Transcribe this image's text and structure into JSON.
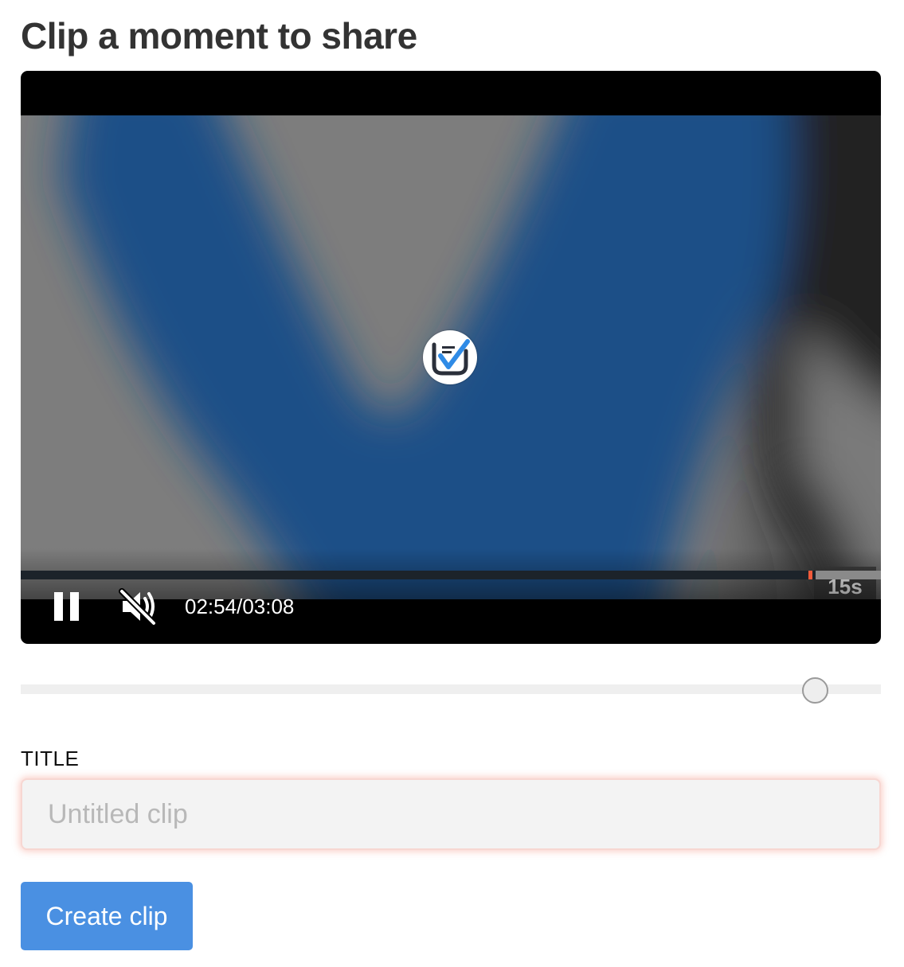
{
  "page": {
    "title": "Clip a moment to share"
  },
  "player": {
    "clip_duration_badge": "15s",
    "time": {
      "current": "02:54",
      "separator": "/",
      "total": "03:08"
    },
    "progress_fraction": 0.924,
    "clip_marker_fraction": 0.916,
    "state": "playing",
    "muted": true,
    "play_pause_icon": "pause-icon",
    "mute_icon": "speaker-muted-icon",
    "center_logo_icon": "checkmark-logo-icon",
    "accent_color": "#f15a3a"
  },
  "clip_range": {
    "start_fraction": 0.923
  },
  "form": {
    "title_label": "TITLE",
    "title_value": "",
    "title_placeholder": "Untitled clip",
    "submit_label": "Create clip",
    "submit_color": "#4a90e2"
  }
}
